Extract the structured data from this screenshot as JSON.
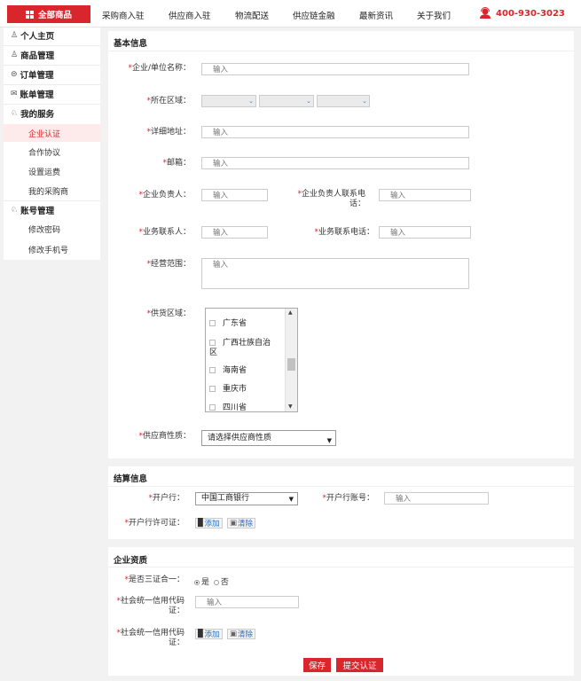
{
  "topnav": {
    "all_products": "全部商品",
    "items": [
      "采购商入驻",
      "供应商入驻",
      "物流配送",
      "供应链金融",
      "最新资讯",
      "关于我们"
    ],
    "phone": "400-930-3023"
  },
  "sidebar": {
    "personal_home": "个人主页",
    "product_mgmt": "商品管理",
    "order_mgmt": "订单管理",
    "bill_mgmt": "账单管理",
    "my_services": "我的服务",
    "services_items": [
      "企业认证",
      "合作协议",
      "设置运费",
      "我的采购商"
    ],
    "account_mgmt": "账号管理",
    "account_items": [
      "修改密码",
      "修改手机号"
    ]
  },
  "basic": {
    "title": "基本信息",
    "company_name_label": "企业/单位名称：",
    "region_label": "所在区域：",
    "address_label": "详细地址：",
    "email_label": "邮箱：",
    "legal_person_label": "企业负责人：",
    "legal_phone_label_1": "企业负责人联系电",
    "legal_phone_label_2": "话：",
    "contact_label": "业务联系人：",
    "contact_phone_label": "业务联系电话：",
    "scope_label": "经营范围：",
    "supply_region_label": "供货区域：",
    "provinces": [
      "广东省",
      "广西壮族自治",
      "区",
      "海南省",
      "重庆市",
      "四川省"
    ],
    "supplier_type_label": "供应商性质：",
    "supplier_type_value": "请选择供应商性质",
    "placeholder": "输入"
  },
  "settle": {
    "title": "结算信息",
    "bank_label": "开户行：",
    "bank_value": "中国工商银行",
    "account_label": "开户行账号：",
    "license_label": "开户行许可证：",
    "add_label": "添加",
    "clear_label": "清除"
  },
  "qual": {
    "title": "企业资质",
    "three_in_one_label": "是否三证合一：",
    "yes": "是",
    "no": "否",
    "credit_code_label_1": "社会统一信用代码",
    "credit_code_label_2": "证：",
    "credit_code_cert_label_1": "社会统一信用代码",
    "credit_code_cert_label_2": "证："
  },
  "actions": {
    "save": "保存",
    "submit": "提交认证"
  },
  "colors": {
    "accent": "#d9262c"
  }
}
